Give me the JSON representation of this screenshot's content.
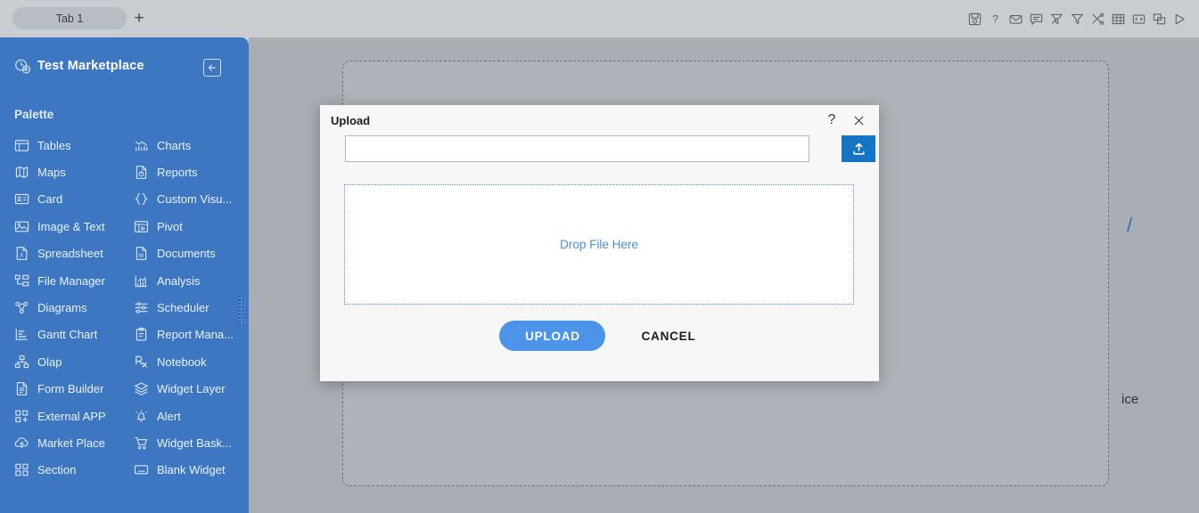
{
  "tabbar": {
    "tabs": [
      {
        "label": "Tab 1"
      }
    ],
    "new_tab_label": "+",
    "icons": [
      {
        "name": "save-icon"
      },
      {
        "name": "help-icon"
      },
      {
        "name": "mail-icon"
      },
      {
        "name": "comment-icon"
      },
      {
        "name": "clear-filter-icon"
      },
      {
        "name": "filter-icon"
      },
      {
        "name": "tools-icon"
      },
      {
        "name": "table-icon"
      },
      {
        "name": "code-icon"
      },
      {
        "name": "copy-icon"
      },
      {
        "name": "play-icon"
      }
    ]
  },
  "sidebar": {
    "title": "Test Marketplace",
    "logo_icon": "dashboard-logo-icon",
    "collapse_icon": "collapse-left-icon",
    "palette_label": "Palette",
    "column1": [
      {
        "label": "Tables",
        "icon": "tables-icon"
      },
      {
        "label": "Maps",
        "icon": "maps-icon"
      },
      {
        "label": "Card",
        "icon": "card-icon"
      },
      {
        "label": "Image & Text",
        "icon": "image-text-icon"
      },
      {
        "label": "Spreadsheet",
        "icon": "spreadsheet-icon"
      },
      {
        "label": "File Manager",
        "icon": "file-manager-icon"
      },
      {
        "label": "Diagrams",
        "icon": "diagrams-icon"
      },
      {
        "label": "Gantt Chart",
        "icon": "gantt-chart-icon"
      },
      {
        "label": "Olap",
        "icon": "olap-icon"
      },
      {
        "label": "Form Builder",
        "icon": "form-builder-icon"
      },
      {
        "label": "External APP",
        "icon": "external-app-icon"
      },
      {
        "label": "Market Place",
        "icon": "market-place-icon"
      },
      {
        "label": "Section",
        "icon": "section-icon"
      }
    ],
    "column2": [
      {
        "label": "Charts",
        "icon": "charts-icon"
      },
      {
        "label": "Reports",
        "icon": "reports-icon"
      },
      {
        "label": "Custom Visu...",
        "icon": "custom-visual-icon"
      },
      {
        "label": "Pivot",
        "icon": "pivot-icon"
      },
      {
        "label": "Documents",
        "icon": "documents-icon"
      },
      {
        "label": "Analysis",
        "icon": "analysis-icon"
      },
      {
        "label": "Scheduler",
        "icon": "scheduler-icon"
      },
      {
        "label": "Report Mana...",
        "icon": "report-manager-icon"
      },
      {
        "label": "Notebook",
        "icon": "notebook-icon"
      },
      {
        "label": "Widget Layer",
        "icon": "widget-layer-icon"
      },
      {
        "label": "Alert",
        "icon": "alert-icon"
      },
      {
        "label": "Widget Bask...",
        "icon": "widget-basket-icon"
      },
      {
        "label": "Blank Widget",
        "icon": "blank-widget-icon"
      }
    ]
  },
  "canvas": {
    "background_fragment_1": "/",
    "background_fragment_2": "ice"
  },
  "dialog": {
    "title": "Upload",
    "help_label": "?",
    "close_icon": "close-icon",
    "path_value": "",
    "path_placeholder": "",
    "browse_icon": "upload-icon",
    "drop_label": "Drop File Here",
    "upload_label": "UPLOAD",
    "cancel_label": "CANCEL"
  },
  "colors": {
    "sidebar_blue": "#3d77c2",
    "accent_blue": "#4c94ea",
    "browse_blue": "#1574c4",
    "canvas_gray": "#a9adb4",
    "dialog_bg": "#f7f7f7",
    "drop_border": "#4a90d9"
  }
}
